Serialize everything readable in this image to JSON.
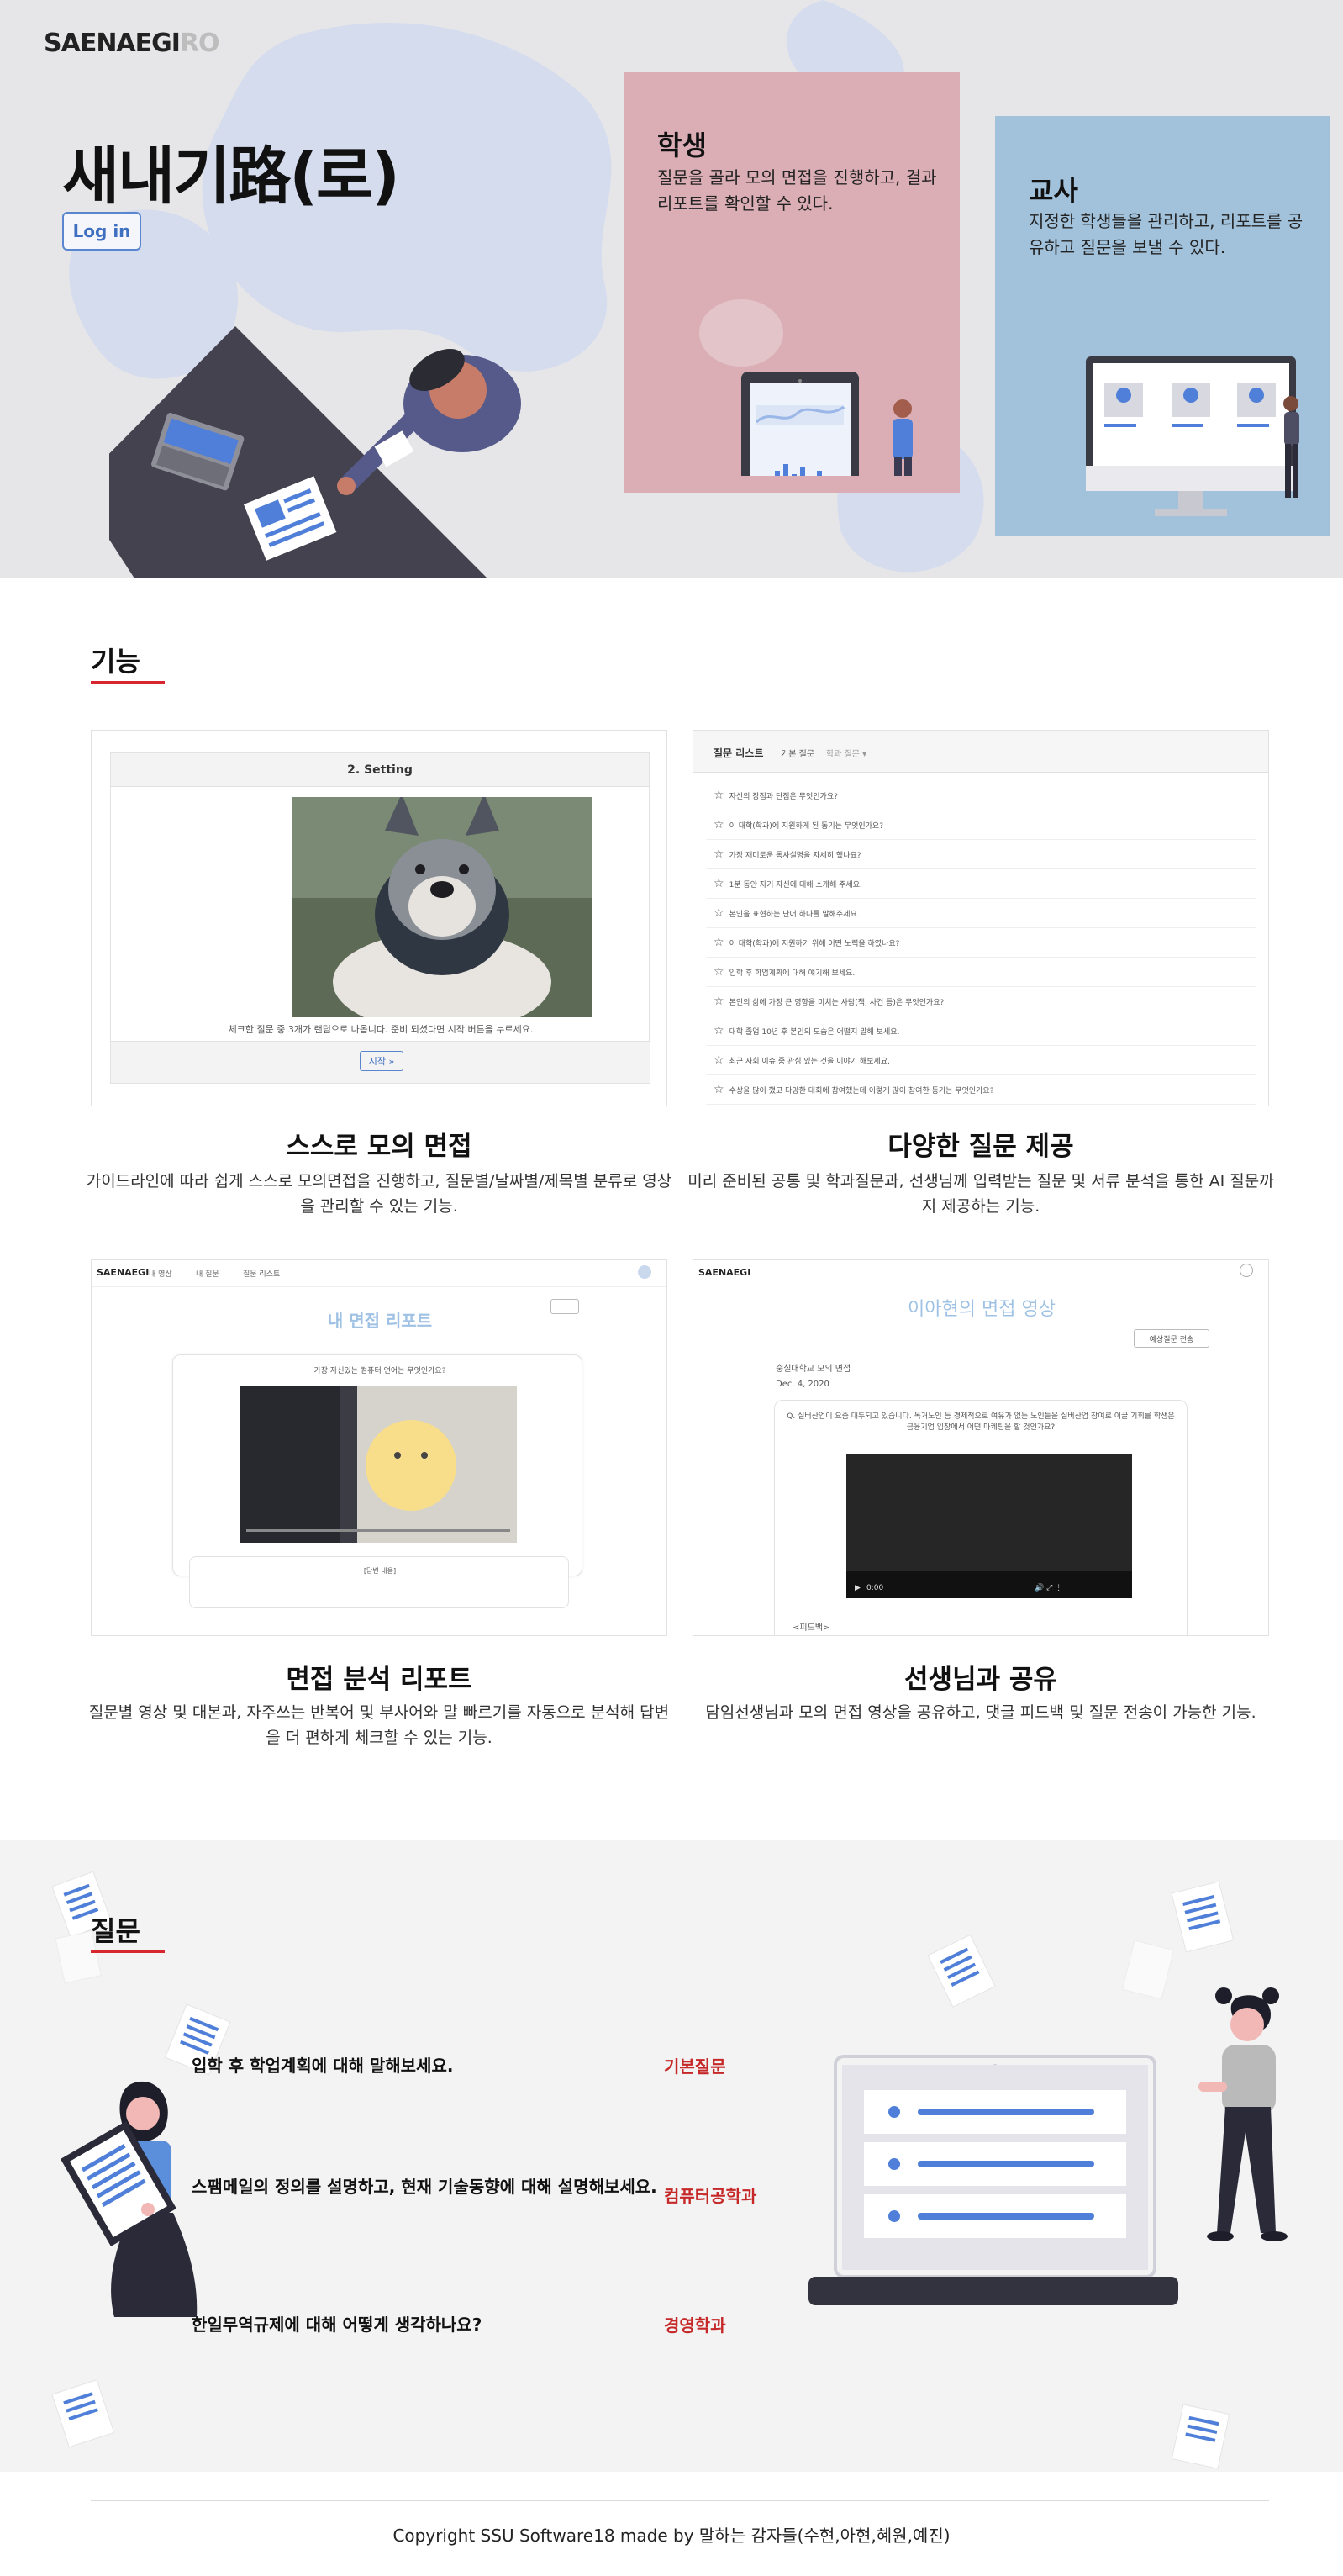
{
  "brand": {
    "logo_main": "SAENAEGI",
    "logo_tail": "RO"
  },
  "hero": {
    "title": "새내기路(로)",
    "login_label": "Log in"
  },
  "cards": {
    "student": {
      "title": "학생",
      "desc": "질문을 골라 모의 면접을 진행하고, 결과 리포트를 확인할 수 있다."
    },
    "teacher": {
      "title": "교사",
      "desc": "지정한 학생들을 관리하고, 리포트를 공유하고 질문을 보낼 수 있다."
    }
  },
  "features": {
    "heading": "기능",
    "items": [
      {
        "title": "스스로 모의 면접",
        "desc": "가이드라인에 따라 쉽게 스스로 모의면접을 진행하고, 질문별/날짜별/제목별 분류로 영상을 관리할 수 있는 기능."
      },
      {
        "title": "다양한 질문 제공",
        "desc": "미리 준비된 공통 및 학과질문과, 선생님께 입력받는 질문 및 서류 분석을 통한 AI 질문까지 제공하는 기능."
      },
      {
        "title": "면접 분석 리포트",
        "desc": "질문별 영상 및 대본과, 자주쓰는 반복어 및 부사어와 말 빠르기를 자동으로 분석해 답변을 더 편하게 체크할 수 있는 기능."
      },
      {
        "title": "선생님과 공유",
        "desc": "담임선생님과 모의 면접 영상을 공유하고, 댓글 피드백 및 질문 전송이 가능한 기능."
      }
    ],
    "setting_mock": {
      "header": "2. Setting",
      "caption": "체크한 질문 중 3개가 랜덤으로 나옵니다. 준비 되셨다면 시작 버튼을 누르세요.",
      "start_label": "시작 »"
    },
    "question_mock": {
      "tab_title": "질문 리스트",
      "tab_basic": "기본 질문",
      "tab_dept": "학과 질문 ▾",
      "rows": [
        "자신의 장점과 단점은 무엇인가요?",
        "이 대학(학과)에 지원하게 된 동기는 무엇인가요?",
        "가장 재미로운 동사설명을 자세히 했나요?",
        "1분 동안 자기 자신에 대해 소개해 주세요.",
        "본인을 표현하는 단어 하나를 말해주세요.",
        "이 대학(학과)에 지원하기 위해 어떤 노력을 하였나요?",
        "입학 후 학업계획에 대해 얘기해 보세요.",
        "본인의 삶에 가장 큰 영향을 미치는 사람(책, 사건 등)은 무엇인가요?",
        "대학 졸업 10년 후 본인의 모습은 어떨지 말해 보세요.",
        "최근 사회 이슈 중 관심 있는 것을 이야기 해보세요.",
        "수상을 많이 했고 다양한 대회에 참여했는데 이렇게 많이 참여한 동기는 무엇인가요?"
      ]
    },
    "report_mock": {
      "brand": "SAENAEGI",
      "nav": [
        "내 영상",
        "내 질문",
        "질문 리스트"
      ],
      "title": "내 면접 리포트",
      "question": "가장 자신있는 컴퓨터 언어는 무엇인가요?",
      "script_label": "[답변 내용]"
    },
    "share_mock": {
      "brand": "SAENAEGI",
      "title": "이아현의 면접 영상",
      "send_label": "예상질문 전송",
      "school": "숭실대학교 모의 면접",
      "date": "Dec. 4, 2020",
      "question": "Q. 실버산업이 요즘 대두되고 있습니다. 독거노인 등 경제적으로 여유가 없는 노인들을 실버산업 참여로 이끌 기회를 학생은 금융기업 입장에서 어떤 마케팅을 할 것인가요?",
      "time": "0:00",
      "feedback_label": "<피드백>"
    }
  },
  "questions": {
    "heading": "질문",
    "items": [
      {
        "text": "입학 후 학업계획에 대해 말해보세요.",
        "category": "기본질문"
      },
      {
        "text": "스팸메일의 정의를 설명하고, 현재 기술동향에 대해 설명해보세요.",
        "category": "컴퓨터공학과"
      },
      {
        "text": "한일무역규제에 대해 어떻게 생각하나요?",
        "category": "경영학과"
      }
    ]
  },
  "footer": {
    "copyright": "Copyright SSU Software18 made by 말하는 감자들(수현,아현,혜원,예진)"
  },
  "colors": {
    "student_card": "#dbaeb6",
    "teacher_card": "#a2c2db",
    "accent_red": "#d8262e",
    "login_blue": "#3e6fc0"
  }
}
